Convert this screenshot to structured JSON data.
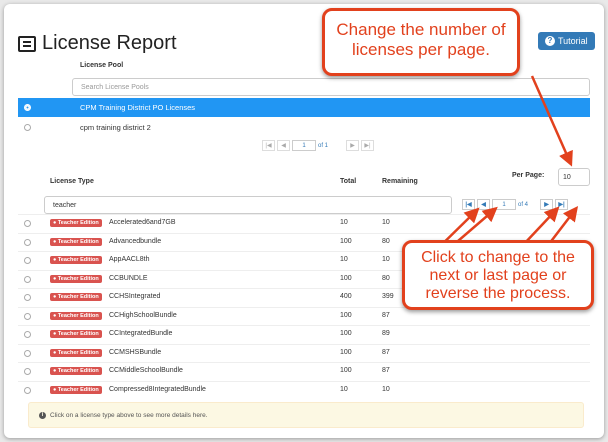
{
  "header": {
    "title": "License Report",
    "tutorial_label": "Tutorial"
  },
  "pools": {
    "column_header": "License Pool",
    "search_placeholder": "Search License Pools",
    "rows": [
      {
        "label": "CPM Training District PO Licenses",
        "selected": true
      },
      {
        "label": "cpm training district 2",
        "selected": false
      }
    ],
    "pager": {
      "page": "1",
      "of_label": "of 1"
    }
  },
  "licenses": {
    "per_page_label": "Per Page:",
    "per_page_value": "10",
    "headers": {
      "type": "License Type",
      "total": "Total",
      "remaining": "Remaining"
    },
    "filter_value": "teacher",
    "pager": {
      "page": "1",
      "of_label": "of 4"
    },
    "badge_label": "Teacher Edition",
    "rows": [
      {
        "name": "Accelerated6and7GB",
        "total": "10",
        "remaining": "10"
      },
      {
        "name": "Advancedbundle",
        "total": "100",
        "remaining": "80"
      },
      {
        "name": "AppAACL8th",
        "total": "10",
        "remaining": "10"
      },
      {
        "name": "CCBUNDLE",
        "total": "100",
        "remaining": "80"
      },
      {
        "name": "CCHSIntegrated",
        "total": "400",
        "remaining": "399"
      },
      {
        "name": "CCHighSchoolBundle",
        "total": "100",
        "remaining": "87"
      },
      {
        "name": "CCIntegratedBundle",
        "total": "100",
        "remaining": "89"
      },
      {
        "name": "CCMSHSBundle",
        "total": "100",
        "remaining": "87"
      },
      {
        "name": "CCMiddleSchoolBundle",
        "total": "100",
        "remaining": "87"
      },
      {
        "name": "Compressed8IntegratedBundle",
        "total": "10",
        "remaining": "10"
      }
    ]
  },
  "info": {
    "text": "Click on a license type above to see more details here."
  },
  "annotations": {
    "callout_top": "Change the number of licenses per page.",
    "callout_bottom": "Click to change to the next or last page or reverse the process."
  },
  "colors": {
    "accent": "#2196f3",
    "badge": "#d9534f",
    "callout": "#e2411d"
  }
}
